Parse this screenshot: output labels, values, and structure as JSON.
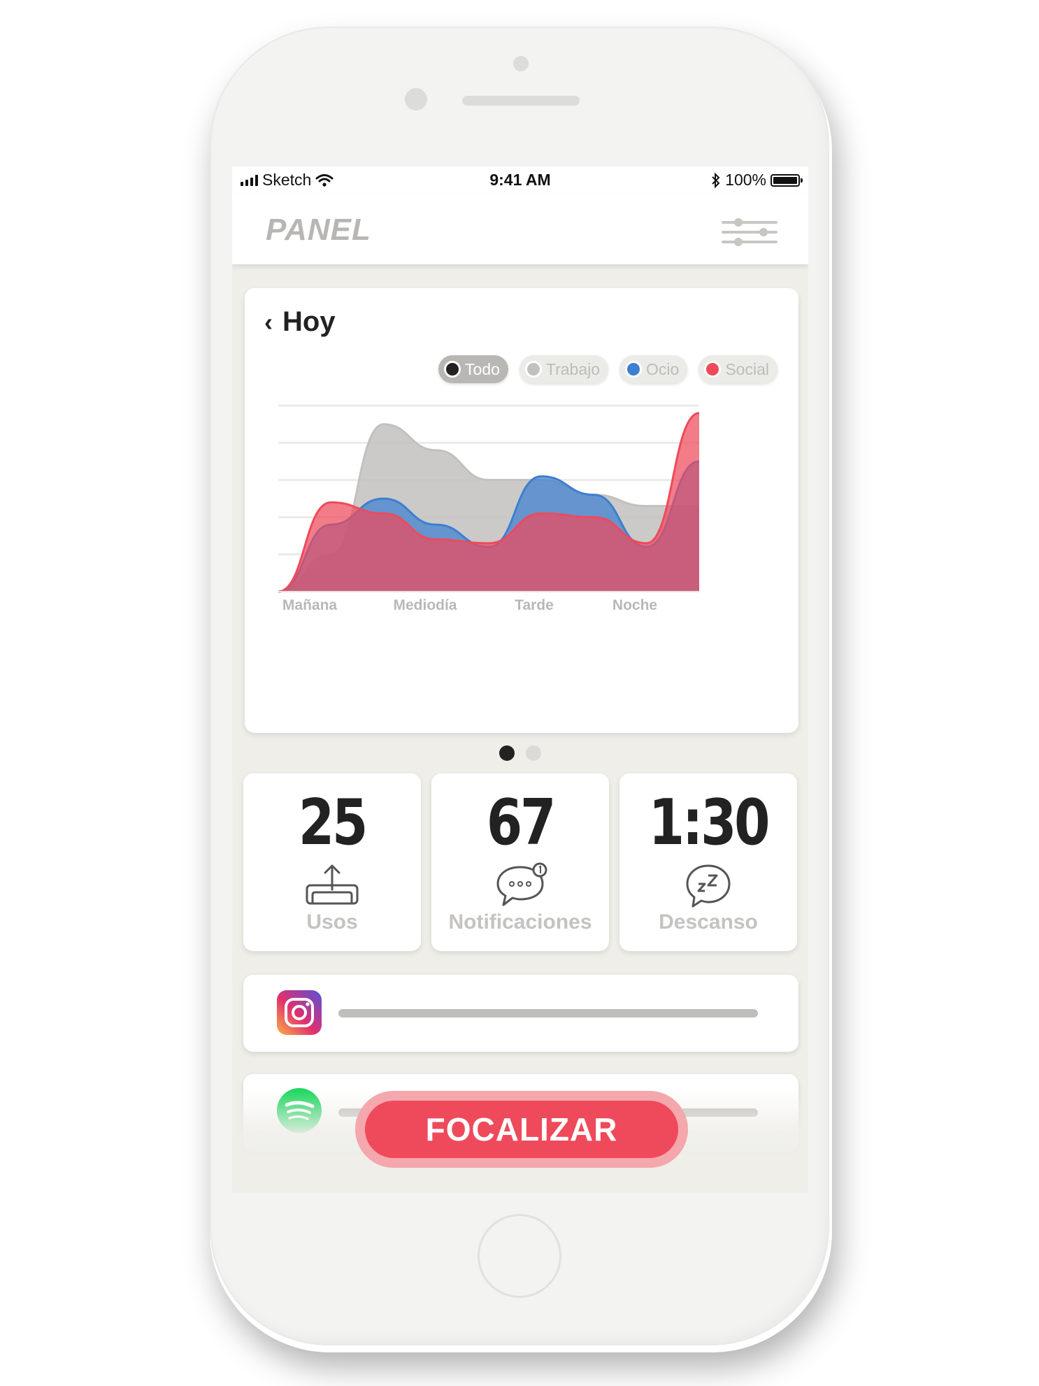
{
  "status_bar": {
    "carrier": "Sketch",
    "time": "9:41 AM",
    "battery": "100%"
  },
  "nav": {
    "title": "PANEL",
    "filter_icon": "sliders-icon"
  },
  "chart_card": {
    "back_icon": "chevron-left-icon",
    "title": "Hoy",
    "legend": [
      {
        "label": "Todo",
        "color": "#222222",
        "active": true
      },
      {
        "label": "Trabajo",
        "color": "#c2c1be",
        "active": false
      },
      {
        "label": "Ocio",
        "color": "#3d7fd0",
        "active": false
      },
      {
        "label": "Social",
        "color": "#ee4a5b",
        "active": false
      }
    ]
  },
  "chart_data": {
    "type": "area",
    "x": [
      0,
      0.5,
      1,
      1.5,
      2,
      2.5,
      3,
      3.5,
      4
    ],
    "categories": [
      "Mañana",
      "Mediodía",
      "Tarde",
      "Noche"
    ],
    "series": [
      {
        "name": "Trabajo",
        "color": "#c2c1be",
        "values": [
          0,
          1.0,
          4.5,
          3.8,
          3.0,
          3.0,
          2.6,
          2.3,
          2.3
        ]
      },
      {
        "name": "Ocio",
        "color": "#3d7fd0",
        "values": [
          0,
          1.8,
          2.5,
          1.8,
          1.2,
          3.1,
          2.6,
          1.2,
          3.5
        ]
      },
      {
        "name": "Social",
        "color": "#ee4a5b",
        "values": [
          0,
          2.4,
          2.1,
          1.4,
          1.3,
          2.1,
          2.0,
          1.3,
          4.8
        ]
      }
    ],
    "ylim": [
      0,
      5
    ],
    "grid": true,
    "legend_position": "top-right"
  },
  "pager": {
    "pages": 2,
    "current": 1
  },
  "stats": [
    {
      "value": "25",
      "label": "Usos",
      "icon": "pickup-phone-icon"
    },
    {
      "value": "67",
      "label": "Notificaciones",
      "icon": "chat-notification-icon"
    },
    {
      "value": "1:30",
      "label": "Descanso",
      "icon": "sleep-bubble-icon"
    }
  ],
  "apps": [
    {
      "name": "Instagram",
      "icon": "instagram-icon",
      "usage": 0.85
    },
    {
      "name": "Spotify",
      "icon": "spotify-icon",
      "usage": 0.85
    }
  ],
  "focus_button": {
    "label": "FOCALIZAR",
    "color": "#ee4a5b"
  }
}
